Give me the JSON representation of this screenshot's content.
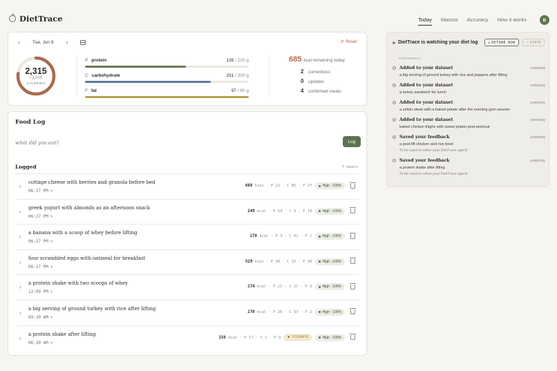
{
  "brand": {
    "name": "DietTrace",
    "icon": "apple-icon"
  },
  "nav": [
    {
      "label": "Today",
      "active": true
    },
    {
      "label": "Macros",
      "active": false
    },
    {
      "label": "Accuracy",
      "active": false
    },
    {
      "label": "How it works",
      "active": false
    }
  ],
  "user": {
    "initial": "B"
  },
  "summary": {
    "date": "Tue, Jun 9",
    "reset_label": "Reset",
    "calories": {
      "value": "2,315",
      "target": "/ 3,000",
      "label": "CALORIES",
      "progress": 0.7717
    },
    "macros": [
      {
        "letter": "P",
        "name": "protein",
        "value": "135",
        "target": "/ 220 g",
        "progress": 0.614,
        "color": "#6a7a59"
      },
      {
        "letter": "C",
        "name": "carbohydrate",
        "value": "231",
        "target": "/ 300 g",
        "progress": 0.77,
        "color": "#5b7aa4"
      },
      {
        "letter": "F",
        "name": "fat",
        "value": "97",
        "target": "/ 80 g",
        "progress": 1.0,
        "color": "#b9a04a"
      }
    ],
    "remaining": {
      "value": "685",
      "label": "kcal remaining today"
    },
    "counts": [
      {
        "n": "2",
        "label": "corrections"
      },
      {
        "n": "0",
        "label": "updates"
      },
      {
        "n": "4",
        "label": "confirmed meals"
      }
    ]
  },
  "foodlog": {
    "title": "Food Log",
    "placeholder": "what did you eat?",
    "log_button": "Log",
    "logged_heading": "Logged",
    "meal_count": "7 meals",
    "meals": [
      {
        "title": "cottage cheese with berries and granola before bed",
        "time": "06:27 PM",
        "kcal": "668",
        "macros": "kcal · P 22 · C 86 · F 27",
        "confidence": "High · 100%",
        "feedback": ""
      },
      {
        "title": "greek yogurt with almonds as an afternoon snack",
        "time": "06:27 PM",
        "kcal": "249",
        "macros": "kcal · P 14 · C 9 · F 19",
        "confidence": "High · 100%",
        "feedback": ""
      },
      {
        "title": "a banana with a scoop of whey before lifting",
        "time": "06:27 PM",
        "kcal": "170",
        "macros": "kcal · P 3 · C 41 · F 1",
        "confidence": "High · 100%",
        "feedback": ""
      },
      {
        "title": "four scrambled eggs with oatmeal for breakfast",
        "time": "06:27 PM",
        "kcal": "529",
        "macros": "kcal · P 30 · C 32 · F 30",
        "confidence": "High · 100%",
        "feedback": ""
      },
      {
        "title": "a protein shake with two scoops of whey",
        "time": "12:00 PM",
        "kcal": "274",
        "macros": "kcal · P 21 · C 27 · F 9",
        "confidence": "High · 100%",
        "feedback": ""
      },
      {
        "title": "a big serving of ground turkey with rice after lifting",
        "time": "09:30 AM",
        "kcal": "270",
        "macros": "kcal · P 28 · C 33 · F 2",
        "confidence": "High · 100%",
        "feedback": ""
      },
      {
        "title": "a protein shake after lifting",
        "time": "06:30 AM",
        "kcal": "156",
        "macros": "kcal · P 17 · C 2 · F 9",
        "confidence": "High · 100%",
        "feedback": "● FEEDBACK"
      }
    ]
  },
  "panel": {
    "title": "DietTrace is watching your diet log",
    "retune_label": "RETUNE NOW",
    "state_label": "STATE",
    "section": "YESTERDAY",
    "events": [
      {
        "head": "Added to your dataset",
        "body": "a big serving of ground turkey with rice and peppers after lifting",
        "note": "",
        "time": "yesterday"
      },
      {
        "head": "Added to your dataset",
        "body": "a turkey sandwich for lunch",
        "note": "",
        "time": "yesterday"
      },
      {
        "head": "Added to your dataset",
        "body": "a sirloin steak with a baked potato after the evening gym session",
        "note": "",
        "time": "yesterday"
      },
      {
        "head": "Added to your dataset",
        "body": "baked chicken thighs with sweet potato post-workout",
        "note": "",
        "time": "yesterday"
      },
      {
        "head": "Saved your feedback",
        "body": "a post-lift chicken and rice bowl",
        "note": "To be used to refine your DietTrace agent!",
        "time": "yesterday"
      },
      {
        "head": "Saved your feedback",
        "body": "a protein shake after lifting",
        "note": "To be used to refine your DietTrace agent!",
        "time": "yesterday"
      }
    ]
  }
}
